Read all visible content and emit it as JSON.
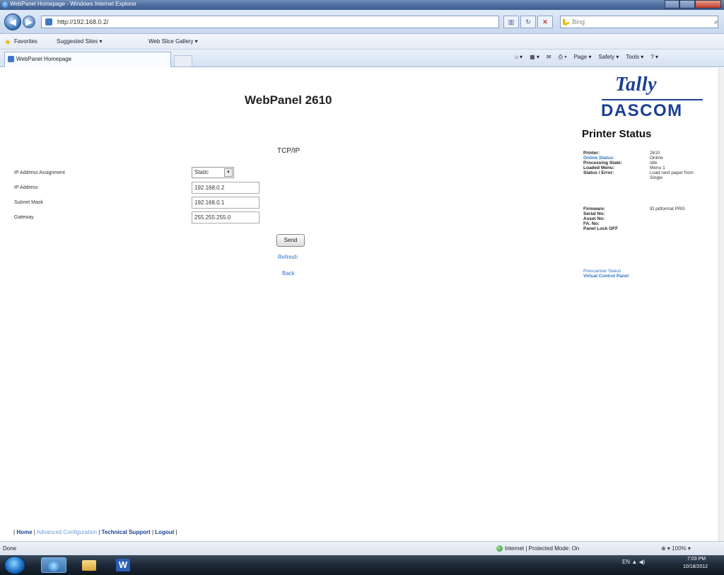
{
  "browser": {
    "window_title": "WebPanel Homepage - Windows Internet Explorer",
    "address": "http://192.168.0.2/",
    "search_placeholder": "Bing",
    "favorites_label": "Favorites",
    "suggested_sites": "Suggested Sites ▾",
    "web_slice_gallery": "Web Slice Gallery ▾",
    "tab_title": "WebPanel Homepage",
    "commands": [
      "Page ▾",
      "Safety ▾",
      "Tools ▾"
    ],
    "status_left": "Done",
    "status_zone": "Internet | Protected Mode: On",
    "zoom": "100%"
  },
  "page": {
    "title": "WebPanel 2610",
    "section": "TCP/IP",
    "logo_top": "Tally",
    "logo_bottom": "DASCOM",
    "form": {
      "ip_assignment_label": "IP Address Assignment",
      "ip_assignment_value": "Static",
      "ip_address_label": "IP Address",
      "ip_address_value": "192.168.0.2",
      "subnet_mask_label": "Subnet Mask",
      "subnet_mask_value": "192.168.0.1",
      "gateway_label": "Gateway",
      "gateway_value": "255.255.255.0"
    },
    "send_label": "Send",
    "refresh_label": "Refresh",
    "back_label": "Back",
    "footer": {
      "home": "Home",
      "advanced": "Advanced Configuration",
      "support": "Technical Support",
      "logout": "Logout"
    }
  },
  "printer_status": {
    "title": "Printer Status",
    "rows": [
      {
        "key": "Printer:",
        "value": "2610"
      },
      {
        "key": "Online Status:",
        "value": "Online"
      },
      {
        "key": "Processing State:",
        "value": "Idle"
      },
      {
        "key": "Loaded Menu:",
        "value": "Menu 1"
      },
      {
        "key": "Status / Error:",
        "value": "Load next paper from"
      },
      {
        "key": "",
        "value": "Single"
      }
    ],
    "firmware_key": "Firmware:",
    "firmware_value": "ID.pdformat PRG",
    "serial_key": "Serial No:",
    "asset_key": "Asset No:",
    "fa_key": "FA. No:",
    "panel_lock": "Panel Lock OFF",
    "link_prescanner": "Prescanner Status",
    "link_vcp": "Virtual Control Panel"
  },
  "taskbar": {
    "tray": "EN",
    "time": "7:03 PM",
    "date": "10/18/2012"
  }
}
